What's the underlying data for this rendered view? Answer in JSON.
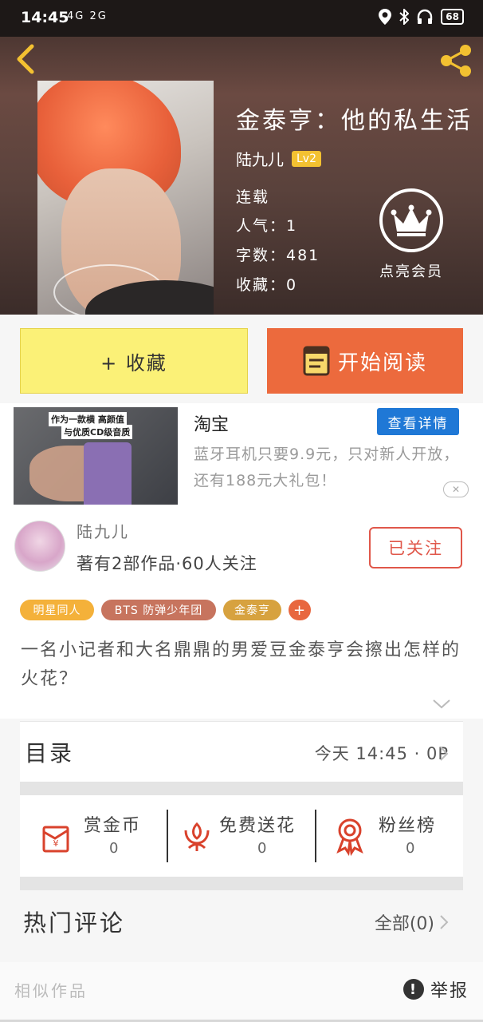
{
  "status_bar": {
    "time": "14:45",
    "signal_text": "4G  2G",
    "battery": "68"
  },
  "book": {
    "title": "金泰亨：他的私生活",
    "author": "陆九儿",
    "level": "Lv2",
    "status": "连载",
    "popularity": "人气：1",
    "word_count": "字数：481",
    "favorites": "收藏：0",
    "vip_label": "点亮会员"
  },
  "actions": {
    "collect_label": "+ 收藏",
    "read_label": "开始阅读"
  },
  "ad": {
    "source": "淘宝",
    "detail_button": "查看详情",
    "description": "蓝牙耳机只要9.9元，只对新人开放，还有188元大礼包！",
    "image_caption_1": "作为一款横 高颜值",
    "image_caption_2": "与优质CD级音质",
    "close": "✕"
  },
  "author_card": {
    "name": "陆九儿",
    "stats": "著有2部作品·60人关注",
    "follow_label": "已关注"
  },
  "tags": [
    {
      "label": "明星同人",
      "color": "#f4b13a"
    },
    {
      "label": "BTS 防弹少年团",
      "color": "#c7745e"
    },
    {
      "label": "金泰亨",
      "color": "#d7a23f"
    },
    {
      "label": "+",
      "color": "#e8673f"
    }
  ],
  "description": "一名小记者和大名鼎鼎的男爱豆金泰亨会擦出怎样的火花？",
  "catalog": {
    "title": "目录",
    "update": "今天 14:45 · 0P"
  },
  "gifts": [
    {
      "label": "赏金币",
      "count": "0",
      "icon": "red-envelope-icon"
    },
    {
      "label": "免费送花",
      "count": "0",
      "icon": "flower-icon"
    },
    {
      "label": "粉丝榜",
      "count": "0",
      "icon": "medal-icon"
    }
  ],
  "comments": {
    "title": "热门评论",
    "all_label": "全部(0)"
  },
  "footer": {
    "similar": "相似作品",
    "report": "举报"
  }
}
